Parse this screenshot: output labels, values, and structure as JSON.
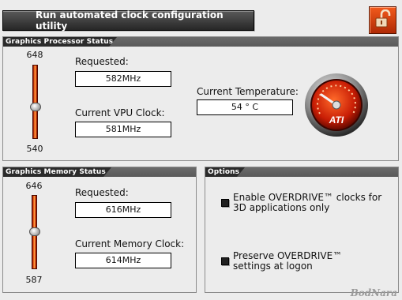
{
  "toolbar": {
    "run_button": "Run automated clock configuration utility",
    "lock_icon": "lock-open-icon"
  },
  "gpu": {
    "header": "Graphics Processor Status",
    "slider_max": "648",
    "slider_min": "540",
    "slider_value": 582,
    "requested_label": "Requested:",
    "requested_value": "582MHz",
    "current_label": "Current VPU Clock:",
    "current_value": "581MHz",
    "temp_label": "Current Temperature:",
    "temp_value": "54 ° C",
    "gauge_logo": "ATI",
    "gauge_icon": "temperature-gauge-icon"
  },
  "memory": {
    "header": "Graphics Memory Status",
    "slider_max": "646",
    "slider_min": "587",
    "slider_value": 616,
    "requested_label": "Requested:",
    "requested_value": "616MHz",
    "current_label": "Current Memory Clock:",
    "current_value": "614MHz"
  },
  "options": {
    "header": "Options",
    "items": [
      {
        "label": "Enable OVERDRIVE™ clocks for 3D applications only",
        "checked": true
      },
      {
        "label": "Preserve OVERDRIVE™ settings at logon",
        "checked": true
      }
    ]
  },
  "watermark": "BodNara",
  "colors": {
    "accent": "#d8341a",
    "panel_header": "#2b2b2b"
  }
}
